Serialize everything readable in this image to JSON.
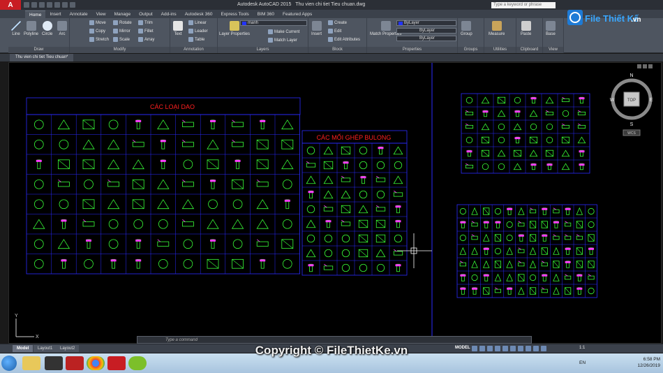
{
  "title_bar": {
    "app_logo": "A",
    "window_title_app": "Autodesk AutoCAD 2015",
    "window_title_file": "Thu vien chi tiet Tieu chuan.dwg",
    "search_placeholder": "Type a keyword or phrase"
  },
  "ribbon_tabs": [
    "Home",
    "Insert",
    "Annotate",
    "View",
    "Manage",
    "Output",
    "Add-ins",
    "Autodesk 360",
    "Express Tools",
    "BIM 360",
    "Featured Apps"
  ],
  "ribbon": {
    "draw": {
      "title": "Draw",
      "tools": [
        "Line",
        "Polyline",
        "Circle",
        "Arc"
      ]
    },
    "modify": {
      "title": "Modify",
      "tools": [
        "Move",
        "Rotate",
        "Trim",
        "Copy",
        "Mirror",
        "Fillet",
        "Stretch",
        "Scale",
        "Array"
      ]
    },
    "annotation": {
      "title": "Annotation",
      "tools": [
        "Text",
        "Linear",
        "Leader",
        "Table"
      ]
    },
    "layers": {
      "title": "Layers",
      "tool": "Layer Properties",
      "layer_name": "manh",
      "make_current": "Make Current",
      "match_layer": "Match Layer"
    },
    "block": {
      "title": "Block",
      "insert": "Insert",
      "create": "Create",
      "edit": "Edit",
      "edit_attributes": "Edit Attributes"
    },
    "properties": {
      "title": "Properties",
      "match": "Match Properties",
      "color": "ByLayer",
      "linetype": "ByLayer",
      "lineweight": "ByLayer"
    },
    "groups": {
      "title": "Groups",
      "tool": "Group"
    },
    "utilities": {
      "title": "Utilities",
      "tool": "Measure"
    },
    "clipboard": {
      "title": "Clipboard",
      "tool": "Paste"
    },
    "view": {
      "title": "View",
      "tool": "Base"
    }
  },
  "doc_tab": "Thu vien chi tiet Tieu chuan*",
  "drawing": {
    "title_1": "CÁC LOẠI DAO",
    "title_2": "CÁC MỐI GHÉP BULONG",
    "viewcube_top": "TOP",
    "viewcube_n": "N",
    "viewcube_s": "S",
    "viewcube_e": "E",
    "viewcube_w": "W",
    "ucs_label": "WCS",
    "axis_x": "X",
    "axis_y": "Y"
  },
  "command_line": {
    "placeholder": "Type a command"
  },
  "layout_tabs": [
    "Model",
    "Layout1",
    "Layout2"
  ],
  "status": {
    "model": "MODEL",
    "scale": "1:1"
  },
  "taskbar": {
    "lang": "EN",
    "time": "6:58 PM",
    "date": "12/26/2019"
  },
  "watermark": {
    "logo_text": "File Thiết Kế",
    "logo_suffix": ".vn",
    "copyright": "Copyright © FileThietKe.vn"
  },
  "colors": {
    "canvas": "#000000",
    "grid_lines": "#2b2bff",
    "symbols_green": "#39ff39",
    "symbols_magenta": "#ff3cff",
    "title_red": "#ff2020"
  }
}
